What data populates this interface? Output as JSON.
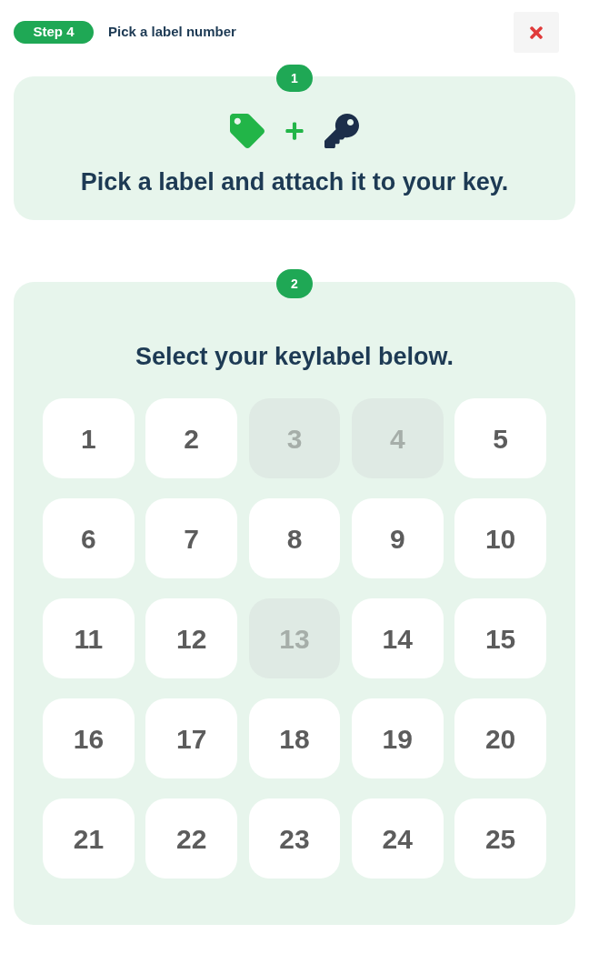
{
  "header": {
    "step_badge": "Step 4",
    "title": "Pick a label number"
  },
  "intro_card": {
    "badge": "1",
    "text": "Pick a label and attach it to your key."
  },
  "selection_card": {
    "badge": "2",
    "heading": "Select your keylabel below.",
    "labels": [
      {
        "number": "1",
        "disabled": false
      },
      {
        "number": "2",
        "disabled": false
      },
      {
        "number": "3",
        "disabled": true
      },
      {
        "number": "4",
        "disabled": true
      },
      {
        "number": "5",
        "disabled": false
      },
      {
        "number": "6",
        "disabled": false
      },
      {
        "number": "7",
        "disabled": false
      },
      {
        "number": "8",
        "disabled": false
      },
      {
        "number": "9",
        "disabled": false
      },
      {
        "number": "10",
        "disabled": false
      },
      {
        "number": "11",
        "disabled": false
      },
      {
        "number": "12",
        "disabled": false
      },
      {
        "number": "13",
        "disabled": true
      },
      {
        "number": "14",
        "disabled": false
      },
      {
        "number": "15",
        "disabled": false
      },
      {
        "number": "16",
        "disabled": false
      },
      {
        "number": "17",
        "disabled": false
      },
      {
        "number": "18",
        "disabled": false
      },
      {
        "number": "19",
        "disabled": false
      },
      {
        "number": "20",
        "disabled": false
      },
      {
        "number": "21",
        "disabled": false
      },
      {
        "number": "22",
        "disabled": false
      },
      {
        "number": "23",
        "disabled": false
      },
      {
        "number": "24",
        "disabled": false
      },
      {
        "number": "25",
        "disabled": false
      }
    ]
  }
}
